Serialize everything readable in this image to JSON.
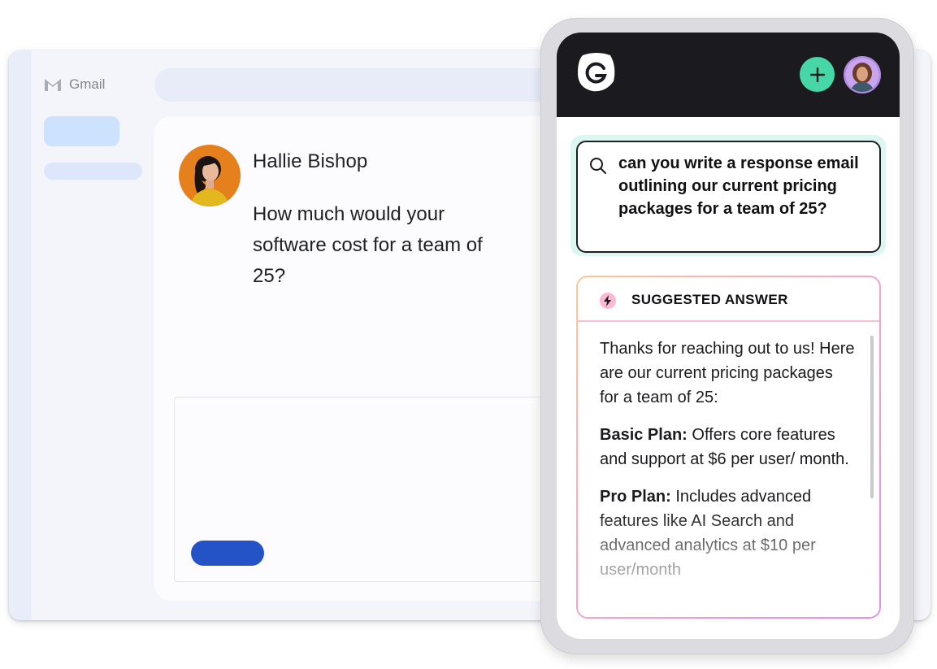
{
  "gmail": {
    "logo_text": "Gmail",
    "email": {
      "sender": "Hallie Bishop",
      "message": "How much would your software cost for a team of 25?"
    }
  },
  "assistant": {
    "query": "can you write a response email outlining our current pricing packages for a team of 25?",
    "answer": {
      "header": "SUGGESTED ANSWER",
      "intro": "Thanks for reaching out to us! Here are our current pricing packages for a team of 25:",
      "plans": [
        {
          "name": "Basic Plan:",
          "description": " Offers core features and support at $6 per user/ month."
        },
        {
          "name": "Pro Plan:",
          "description": " Includes advanced features like AI Search and advanced analytics at $10 per user/month"
        }
      ]
    }
  },
  "colors": {
    "accent_green": "#47d7a6",
    "send_blue": "#2353c7",
    "header_dark": "#1b1b1f"
  },
  "icons": [
    "gmail-icon",
    "search-icon",
    "plus-icon",
    "bolt-icon",
    "app-logo-icon"
  ]
}
